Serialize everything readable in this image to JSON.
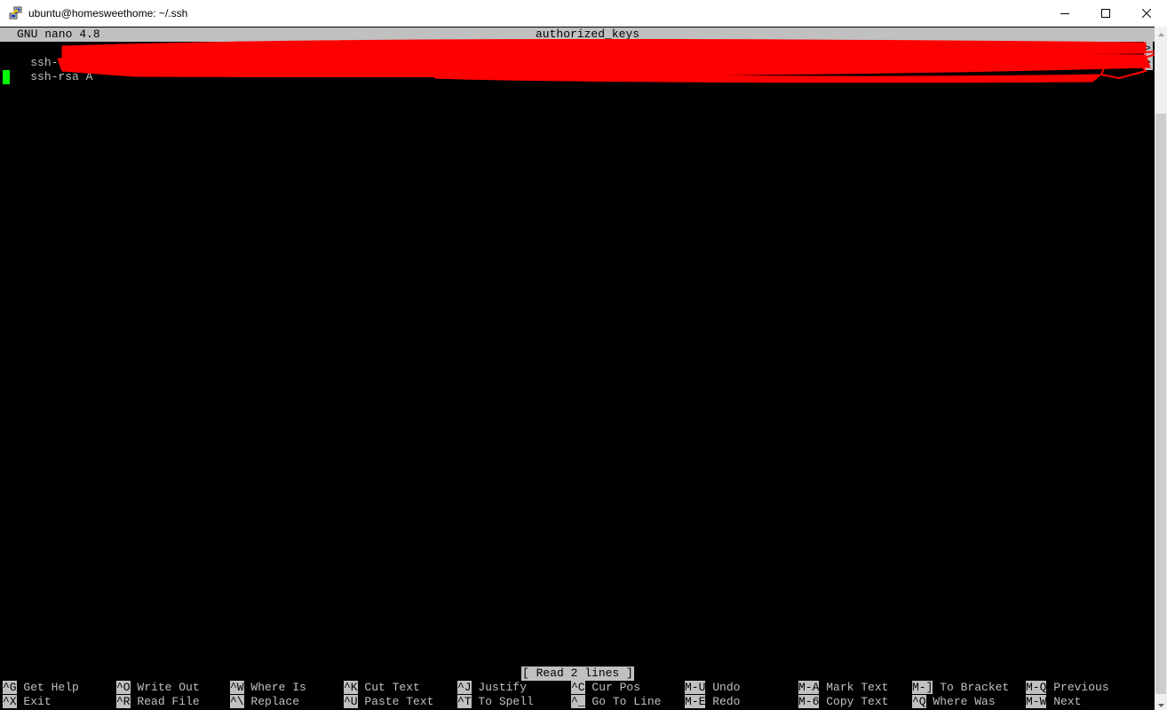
{
  "window": {
    "title": "ubuntu@homesweethome: ~/.ssh",
    "icon": "putty-icon",
    "controls": {
      "minimize": "minimize-icon",
      "maximize": "maximize-icon",
      "close": "close-icon"
    }
  },
  "editor": {
    "version": "GNU nano 4.8",
    "filename": "authorized_keys",
    "lines": [
      {
        "prefix": "ssh-rsa A",
        "redacted": true,
        "truncated_marker": ">"
      },
      {
        "prefix": "ssh-rsa A",
        "redacted": true,
        "truncated_marker": ">"
      }
    ],
    "cursor_color": "#00ff00",
    "status_message": "[ Read 2 lines ]"
  },
  "shortcuts": [
    {
      "key": "^G",
      "label": "Get Help"
    },
    {
      "key": "^X",
      "label": "Exit"
    },
    {
      "key": "^O",
      "label": "Write Out"
    },
    {
      "key": "^R",
      "label": "Read File"
    },
    {
      "key": "^W",
      "label": "Where Is"
    },
    {
      "key": "^\\",
      "label": "Replace"
    },
    {
      "key": "^K",
      "label": "Cut Text"
    },
    {
      "key": "^U",
      "label": "Paste Text"
    },
    {
      "key": "^J",
      "label": "Justify"
    },
    {
      "key": "^T",
      "label": "To Spell"
    },
    {
      "key": "^C",
      "label": "Cur Pos"
    },
    {
      "key": "^_",
      "label": "Go To Line"
    },
    {
      "key": "M-U",
      "label": "Undo"
    },
    {
      "key": "M-E",
      "label": "Redo"
    },
    {
      "key": "M-A",
      "label": "Mark Text"
    },
    {
      "key": "M-6",
      "label": "Copy Text"
    },
    {
      "key": "M-]",
      "label": "To Bracket"
    },
    {
      "key": "^Q",
      "label": "Where Was"
    },
    {
      "key": "M-Q",
      "label": "Previous"
    },
    {
      "key": "M-W",
      "label": "Next"
    }
  ],
  "colors": {
    "terminal_bg": "#000000",
    "terminal_fg": "#c0c0c0",
    "inverse_bg": "#c0c0c0",
    "redaction": "#ff0000"
  }
}
